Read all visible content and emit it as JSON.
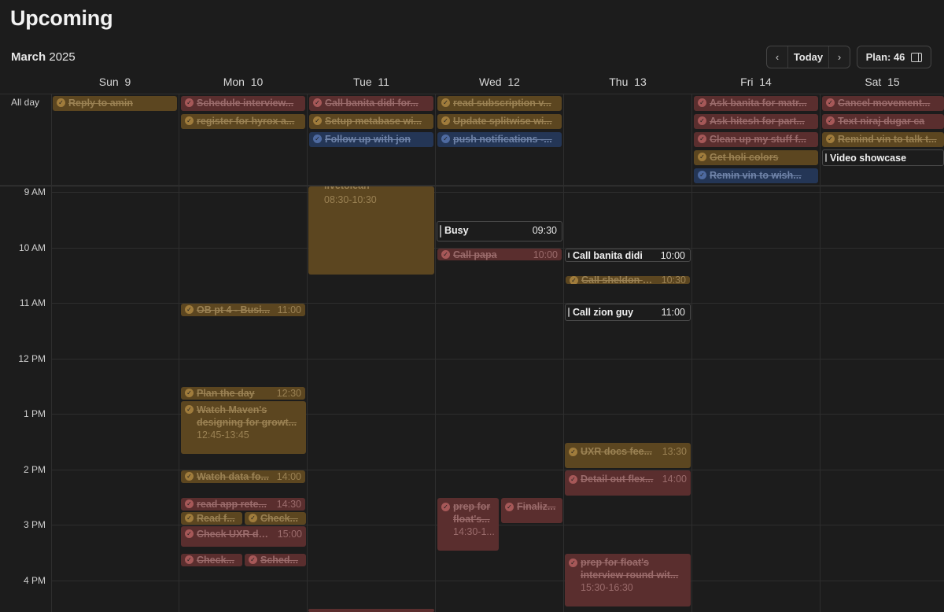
{
  "header": {
    "title": "Upcoming",
    "month": "March",
    "year": "2025",
    "today_label": "Today",
    "plan_label": "Plan: 46",
    "prev_icon": "chevron-left-icon",
    "next_icon": "chevron-right-icon"
  },
  "days": [
    {
      "name": "Sun",
      "num": "9"
    },
    {
      "name": "Mon",
      "num": "10"
    },
    {
      "name": "Tue",
      "num": "11"
    },
    {
      "name": "Wed",
      "num": "12"
    },
    {
      "name": "Thu",
      "num": "13"
    },
    {
      "name": "Fri",
      "num": "14"
    },
    {
      "name": "Sat",
      "num": "15"
    }
  ],
  "allday_label": "All day",
  "hours": [
    "9 AM",
    "10 AM",
    "11 AM",
    "12 PM",
    "1 PM",
    "2 PM",
    "3 PM",
    "4 PM"
  ],
  "allday_events": {
    "sun": [
      "Reply to amin"
    ],
    "mon": [
      "Schedule interview...",
      "register for hyrox a..."
    ],
    "tue": [
      "Call banita didi for...",
      "Setup metabase wi...",
      "Follow up with jon"
    ],
    "wed": [
      "read subscription v...",
      "Update splitwise wi...",
      "push notifications -..."
    ],
    "fri": [
      "Ask banita for matr...",
      "Ask hitesh for part...",
      "Clean up my stuff f...",
      "Get holi colors",
      "Remin vin to wish..."
    ],
    "sat": [
      "Cancel movement...",
      "Text niraj dugar ca",
      "Remind vin to talk t...",
      "Video showcase"
    ]
  },
  "events": {
    "tue_livetolean": {
      "title": "livetolean",
      "range": "08:30-10:30"
    },
    "wed_busy": {
      "title": "Busy",
      "time": "09:30"
    },
    "wed_call_papa": {
      "title": "Call papa",
      "time": "10:00"
    },
    "thu_call_banita": {
      "title": "Call banita didi",
      "time": "10:00"
    },
    "thu_call_sheldon": {
      "title": "Call sheldon fr...",
      "time": "10:30"
    },
    "thu_call_zion": {
      "title": "Call zion guy",
      "time": "11:00"
    },
    "mon_ob": {
      "title": "OB pt 4 - Busi...",
      "time": "11:00"
    },
    "mon_plan": {
      "title": "Plan the day",
      "time": "12:30"
    },
    "mon_maven": {
      "title": "Watch Maven's designing for growt...",
      "range": "12:45-13:45"
    },
    "mon_watch_data": {
      "title": "Watch data fo...",
      "time": "14:00"
    },
    "mon_read_app": {
      "title": "read app rete...",
      "time": "14:30"
    },
    "mon_read_f": {
      "title": "Read f..."
    },
    "mon_check_a": {
      "title": "Check..."
    },
    "mon_check_uxr": {
      "title": "Check UXR do...",
      "time": "15:00"
    },
    "mon_check_b": {
      "title": "Check..."
    },
    "mon_sched": {
      "title": "Sched..."
    },
    "thu_uxr_docs": {
      "title": "UXR docs fee...",
      "time": "13:30"
    },
    "thu_detail_flex": {
      "title": "Detail out flex...",
      "time": "14:00"
    },
    "wed_prep_float": {
      "title": "prep for float's...",
      "range": "14:30-1..."
    },
    "wed_finalize": {
      "title": "Finaliz..."
    },
    "thu_prep_float": {
      "title": "prep for float's interview round wit...",
      "range": "15:30-16:30"
    }
  }
}
